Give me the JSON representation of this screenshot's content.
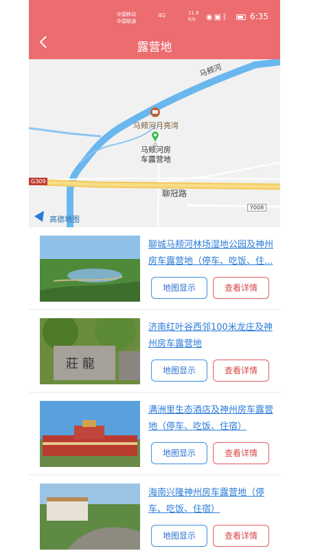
{
  "status_bar": {
    "carrier_1": "中国移动",
    "carrier_2": "中国联通",
    "network": "4G",
    "speed_value": "11.8",
    "speed_unit": "K/s",
    "time": "6:35",
    "battery_icon": "battery-icon"
  },
  "header": {
    "title": "露营地",
    "back_icon": "chevron-left-icon"
  },
  "map": {
    "river_label": "马颊河",
    "poi_label": "马颊河月亮湾",
    "marker_label_line1": "马颊河房",
    "marker_label_line2": "车露营地",
    "road_label": "聊冠路",
    "highway_badge": "G309",
    "road_code": "Y008",
    "provider": "高德地图",
    "colors": {
      "water": "#6ab7ee",
      "road": "#f6d36b",
      "land": "#f1f1f1"
    }
  },
  "campsites": [
    {
      "name": "聊城马颊河林场湿地公园及神州房车露营地（停车、吃饭、住...",
      "map_button": "地图显示",
      "detail_button": "查看详情"
    },
    {
      "name": "济南红叶谷西邻100米龙庄及神州房车露营地",
      "map_button": "地图显示",
      "detail_button": "查看详情"
    },
    {
      "name": "满洲里生态酒店及神州房车露营地（停车、吃饭、住宿）",
      "map_button": "地图显示",
      "detail_button": "查看详情"
    },
    {
      "name": "海南兴隆神州房车露营地（停车、吃饭、住宿）",
      "map_button": "地图显示",
      "detail_button": "查看详情"
    }
  ],
  "colors": {
    "header_bg": "#ec6c6f",
    "link": "#2a7bd8",
    "map_btn": "#3b8ee0",
    "detail_btn": "#e25a5a"
  }
}
